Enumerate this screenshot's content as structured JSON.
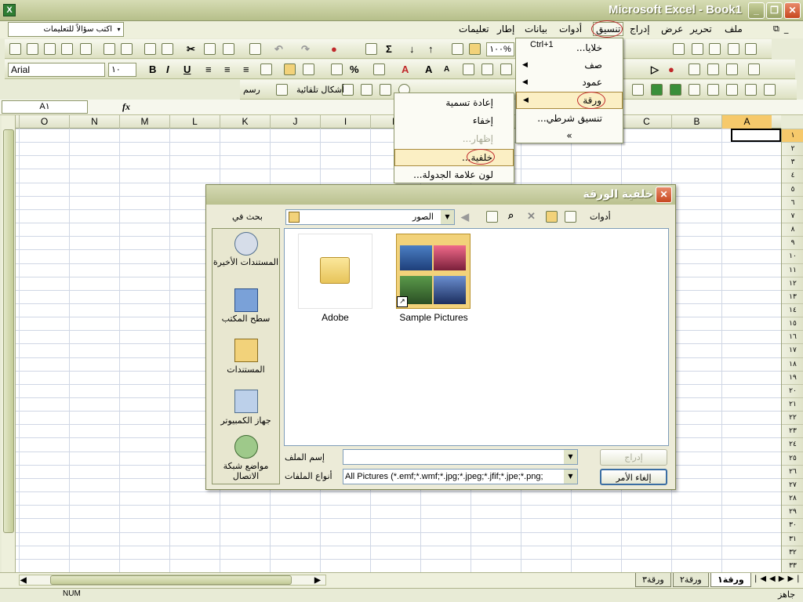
{
  "window": {
    "title": "Microsoft Excel - Book1",
    "icon": "excel-icon",
    "min": "_",
    "max": "❐",
    "close": "✕"
  },
  "help_box": {
    "placeholder": "اكتب سؤالاً للتعليمات"
  },
  "menubar": {
    "items": [
      "ملف",
      "تحرير",
      "عرض",
      "إدراج",
      "تنسيق",
      "أدوات",
      "بيانات",
      "إطار",
      "تعليمات"
    ]
  },
  "toolbar": {
    "font": "Arial",
    "font_size": "١٠",
    "zoom": "١٠٠%",
    "draw": "رسم",
    "autoshapes": "أشكال تلقائية"
  },
  "formula_bar": {
    "name_box": "A١",
    "fx": "fx"
  },
  "columns": [
    "O",
    "N",
    "M",
    "L",
    "K",
    "J",
    "I",
    "H",
    "G",
    "F",
    "E",
    "D",
    "C",
    "B",
    "A"
  ],
  "rows": [
    "١",
    "٢",
    "٣",
    "٤",
    "٥",
    "٦",
    "٧",
    "٨",
    "٩",
    "١٠",
    "١١",
    "١٢",
    "١٣",
    "١٤",
    "١٥",
    "١٦",
    "١٧",
    "١٨",
    "١٩",
    "٢٠",
    "٢١",
    "٢٢",
    "٢٣",
    "٢٤",
    "٢٥",
    "٢٦",
    "٢٧",
    "٢٨",
    "٢٩",
    "٣٠",
    "٣١",
    "٣٢",
    "٣٣"
  ],
  "format_menu": [
    {
      "label": "خلايا...",
      "shortcut": "Ctrl+1"
    },
    {
      "label": "صف",
      "arrow": "◀"
    },
    {
      "label": "عمود",
      "arrow": "◀"
    },
    {
      "label": "ورقة",
      "arrow": "◀"
    },
    {
      "label": "تنسيق شرطي..."
    },
    {
      "label": "»"
    }
  ],
  "sheet_submenu": [
    {
      "label": "إعادة تسمية"
    },
    {
      "label": "إخفاء"
    },
    {
      "label": "إظهار..."
    },
    {
      "label": "خلفية..."
    },
    {
      "label": "لون علامة الجدولة..."
    }
  ],
  "dialog": {
    "title": "خلفية الورقة",
    "look_in_label": "بحث في",
    "look_in_value": "الصور",
    "tools_label": "أدوات",
    "places": [
      "المستندات الأخيرة",
      "سطح المكتب",
      "المستندات",
      "جهاز الكمبيوتر",
      "مواضع شبكة الاتصال"
    ],
    "files": [
      "Adobe",
      "Sample Pictures"
    ],
    "filename_label": "إسم الملف",
    "filename_value": "",
    "filetype_label": "أنواع الملفات",
    "filetype_value": "All Pictures (*.emf;*.wmf;*.jpg;*.jpeg;*.jfif;*.jpe;*.png;",
    "insert_label": "إدراج",
    "cancel_label": "إلغاء الأمر"
  },
  "sheets": [
    "ورقة١",
    "ورقة٢",
    "ورقة٣"
  ],
  "status": {
    "ready": "جاهز",
    "num": "NUM"
  },
  "colors": {
    "accent": "#c0282a",
    "title_bar": "#b6bf8a",
    "highlight": "#fbefc4"
  }
}
